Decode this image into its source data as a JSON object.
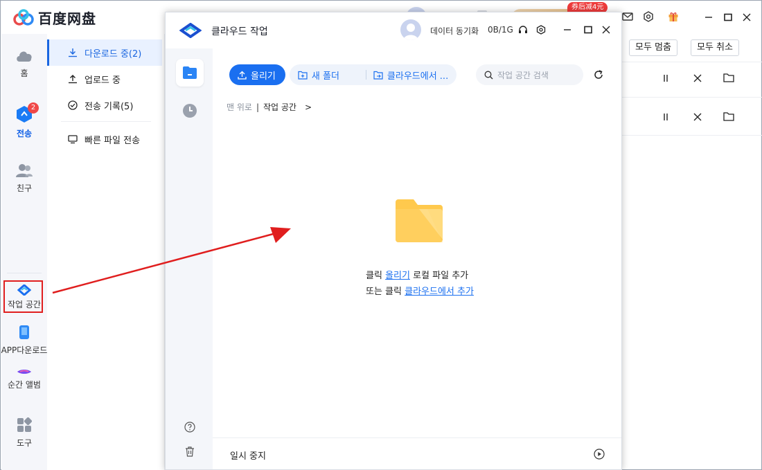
{
  "app": {
    "name": "百度网盘",
    "coupon": "券后减4元"
  },
  "rail": {
    "items": [
      {
        "label": "홈"
      },
      {
        "label": "전송",
        "badge": "2"
      },
      {
        "label": "친구"
      },
      {
        "label": "작업 공간"
      },
      {
        "label": "APP다운로드"
      },
      {
        "label": "순간 앨범"
      },
      {
        "label": "도구"
      }
    ]
  },
  "subnav": {
    "items": [
      {
        "label": "다운로드 중(2)",
        "icon": "download-icon"
      },
      {
        "label": "업로드 중",
        "icon": "upload-icon"
      },
      {
        "label": "전송 기록(5)",
        "icon": "check-circle-icon"
      },
      {
        "label": "빠른 파일 전송",
        "icon": "monitor-icon"
      }
    ]
  },
  "transfers": {
    "pause_all": "모두 멈춤",
    "cancel_all": "모두 취소"
  },
  "dialog": {
    "title": "클라우드 작업",
    "sync_label": "데이터 동기화",
    "quota": "0B/1G",
    "toolbar": {
      "upload": "올리기",
      "new_folder": "새 폴더",
      "from_cloud": "클라우드에서 ...",
      "search_placeholder": "작업 공간 검색"
    },
    "breadcrumb": {
      "root": "맨 위로",
      "separator": "|",
      "current": "작업 공간",
      "arrow": ">"
    },
    "empty": {
      "line1_prefix": "클릭 ",
      "line1_link": "올리기",
      "line1_suffix": " 로컬 파일 추가",
      "line2_prefix": "또는 클릭 ",
      "line2_link": "클라우드에서 추가"
    },
    "footer_label": "일시 중지"
  },
  "colors": {
    "accent": "#1a6ff0",
    "annotation_red": "#e01e1e",
    "folder_yellow": "#ffc94d"
  }
}
